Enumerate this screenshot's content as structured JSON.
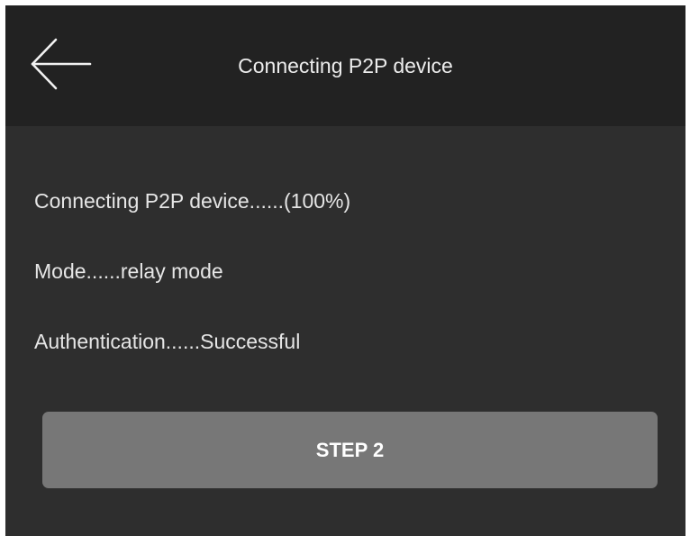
{
  "header": {
    "title": "Connecting P2P device",
    "back_icon": "arrow-left-icon"
  },
  "status": {
    "connecting": "Connecting P2P device......(100%)",
    "mode": "Mode......relay mode",
    "authentication": "Authentication......Successful"
  },
  "actions": {
    "step_label": "STEP 2"
  },
  "colors": {
    "header_bg": "#222222",
    "body_bg": "#2e2e2e",
    "button_bg": "#777777",
    "text": "#e6e6e6"
  }
}
